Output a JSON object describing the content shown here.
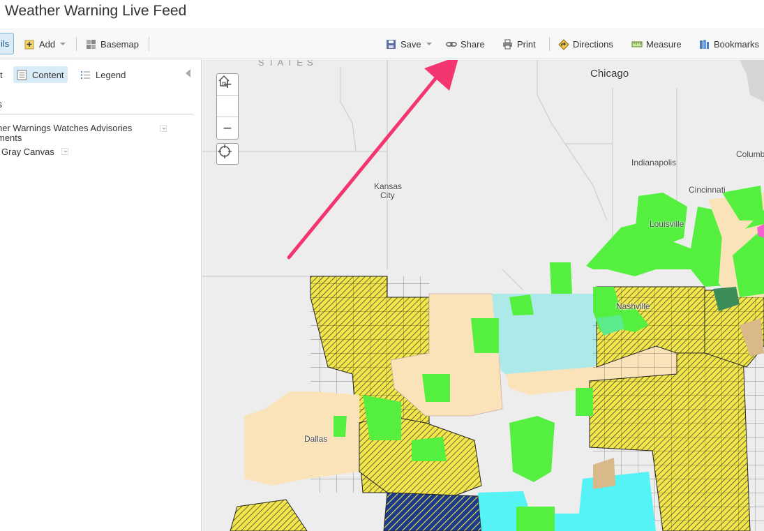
{
  "app": {
    "title": "Weather Warning Live Feed"
  },
  "toolbar": {
    "details_label": "ils",
    "add_label": "Add",
    "basemap_label": "Basemap",
    "save_label": "Save",
    "share_label": "Share",
    "print_label": "Print",
    "directions_label": "Directions",
    "measure_label": "Measure",
    "bookmarks_label": "Bookmarks"
  },
  "sidebar": {
    "about_tab_fragment": "t",
    "content_tab": "Content",
    "legend_tab": "Legend",
    "heading_fragment": "s",
    "layers": [
      {
        "line1": "her Warnings Watches Advisories",
        "line2": "ments"
      },
      {
        "line1": "Gray Canvas"
      }
    ]
  },
  "map": {
    "states_label": "STATES",
    "cities": [
      "Chicago",
      "Indianapolis",
      "Columb",
      "Kansas",
      "City",
      "Cincinnati",
      "Louisville",
      "Nashville",
      "Dallas"
    ],
    "colors": {
      "warning_yellow": "#f2e64a",
      "advisory_tan": "#fbe3b9",
      "watch_green": "#55f03f",
      "cyan": "#aee9ea",
      "bright_cyan": "#55f2f6",
      "dark_green": "#3c8c5a",
      "navy": "#1c3a8a",
      "annotation_arrow": "#f3366f"
    }
  }
}
